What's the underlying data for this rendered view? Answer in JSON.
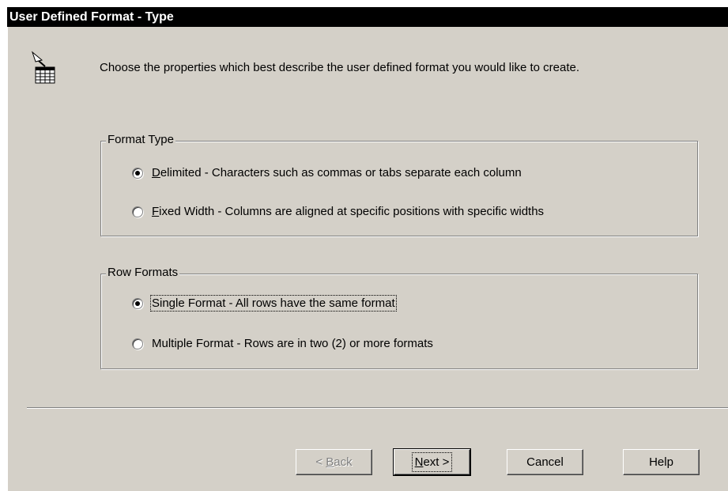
{
  "window": {
    "title": "User Defined Format - Type"
  },
  "intro_text": "Choose the properties which best describe the user defined format you would like to create.",
  "format_type": {
    "legend": "Format Type",
    "options": [
      {
        "mnemonic": "D",
        "rest": "elimited - Characters such as commas or tabs separate each column",
        "selected": true
      },
      {
        "mnemonic": "F",
        "rest": "ixed Width - Columns are aligned at specific positions with specific widths",
        "selected": false
      }
    ]
  },
  "row_formats": {
    "legend": "Row Formats",
    "options": [
      {
        "label": "Single Format - All rows have the same format",
        "selected": true
      },
      {
        "label": "Multiple Format - Rows are in two (2) or more formats",
        "selected": false
      }
    ]
  },
  "buttons": {
    "back": {
      "prefix": "< ",
      "mnemonic": "B",
      "rest": "ack",
      "enabled": false
    },
    "next": {
      "mnemonic": "N",
      "rest": "ext >",
      "enabled": true
    },
    "cancel": {
      "label": "Cancel"
    },
    "help": {
      "label": "Help"
    }
  },
  "icon": "table-wizard-icon"
}
